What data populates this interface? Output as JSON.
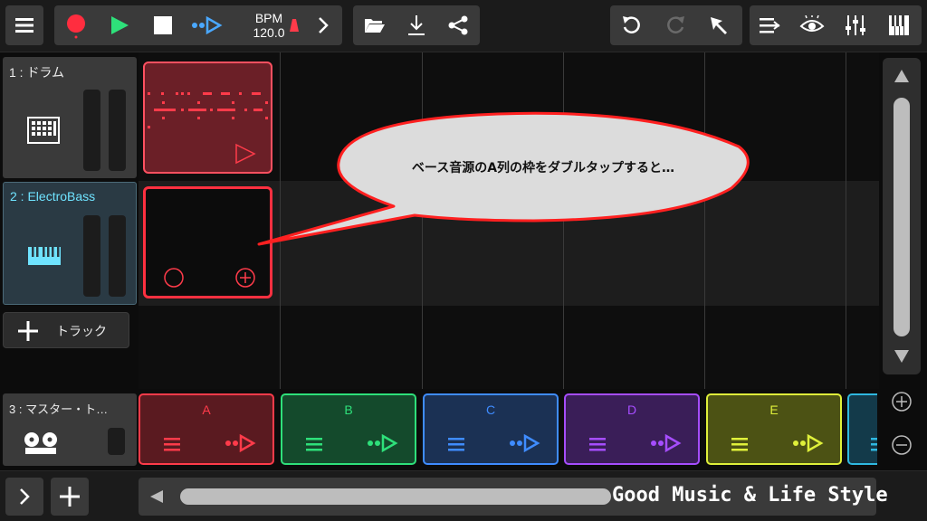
{
  "toolbar": {
    "bpm_label": "BPM",
    "bpm_value": "120.0",
    "icons": [
      "menu-icon",
      "record-icon",
      "play-icon",
      "stop-icon",
      "step-icon",
      "metronome-icon",
      "next-icon",
      "folder-icon",
      "download-icon",
      "share-icon",
      "undo-icon",
      "redo-icon",
      "select-icon",
      "mixer-list-icon",
      "eye-icon",
      "equalizer-icon",
      "piano-icon"
    ]
  },
  "tracks": [
    {
      "label": "1 : ドラム",
      "icon": "drum-machine-icon",
      "color": "#ffffff"
    },
    {
      "label": "2 : ElectroBass",
      "icon": "keyboard-icon",
      "color": "#6fe3ff"
    }
  ],
  "add_track": {
    "label": "トラック",
    "icon": "plus-icon"
  },
  "master": {
    "label": "3 : マスター・ト…",
    "icon": "tape-reels-icon"
  },
  "callout": {
    "text": "ベース音源のA列の枠をダブルタップすると…"
  },
  "scenes": [
    {
      "label": "A",
      "color": "#ff3b4a",
      "bg": "#5a1a20"
    },
    {
      "label": "B",
      "color": "#2ee07a",
      "bg": "#144a2c"
    },
    {
      "label": "C",
      "color": "#3f8cff",
      "bg": "#1b3154"
    },
    {
      "label": "D",
      "color": "#a64dff",
      "bg": "#3a1e58"
    },
    {
      "label": "E",
      "color": "#dff03a",
      "bg": "#4c5214"
    }
  ],
  "watermark": "Good Music & Life Style",
  "colors": {
    "accent_red": "#ff3b4a",
    "accent_cyan": "#6fe3ff",
    "play_green": "#2ee07a"
  }
}
